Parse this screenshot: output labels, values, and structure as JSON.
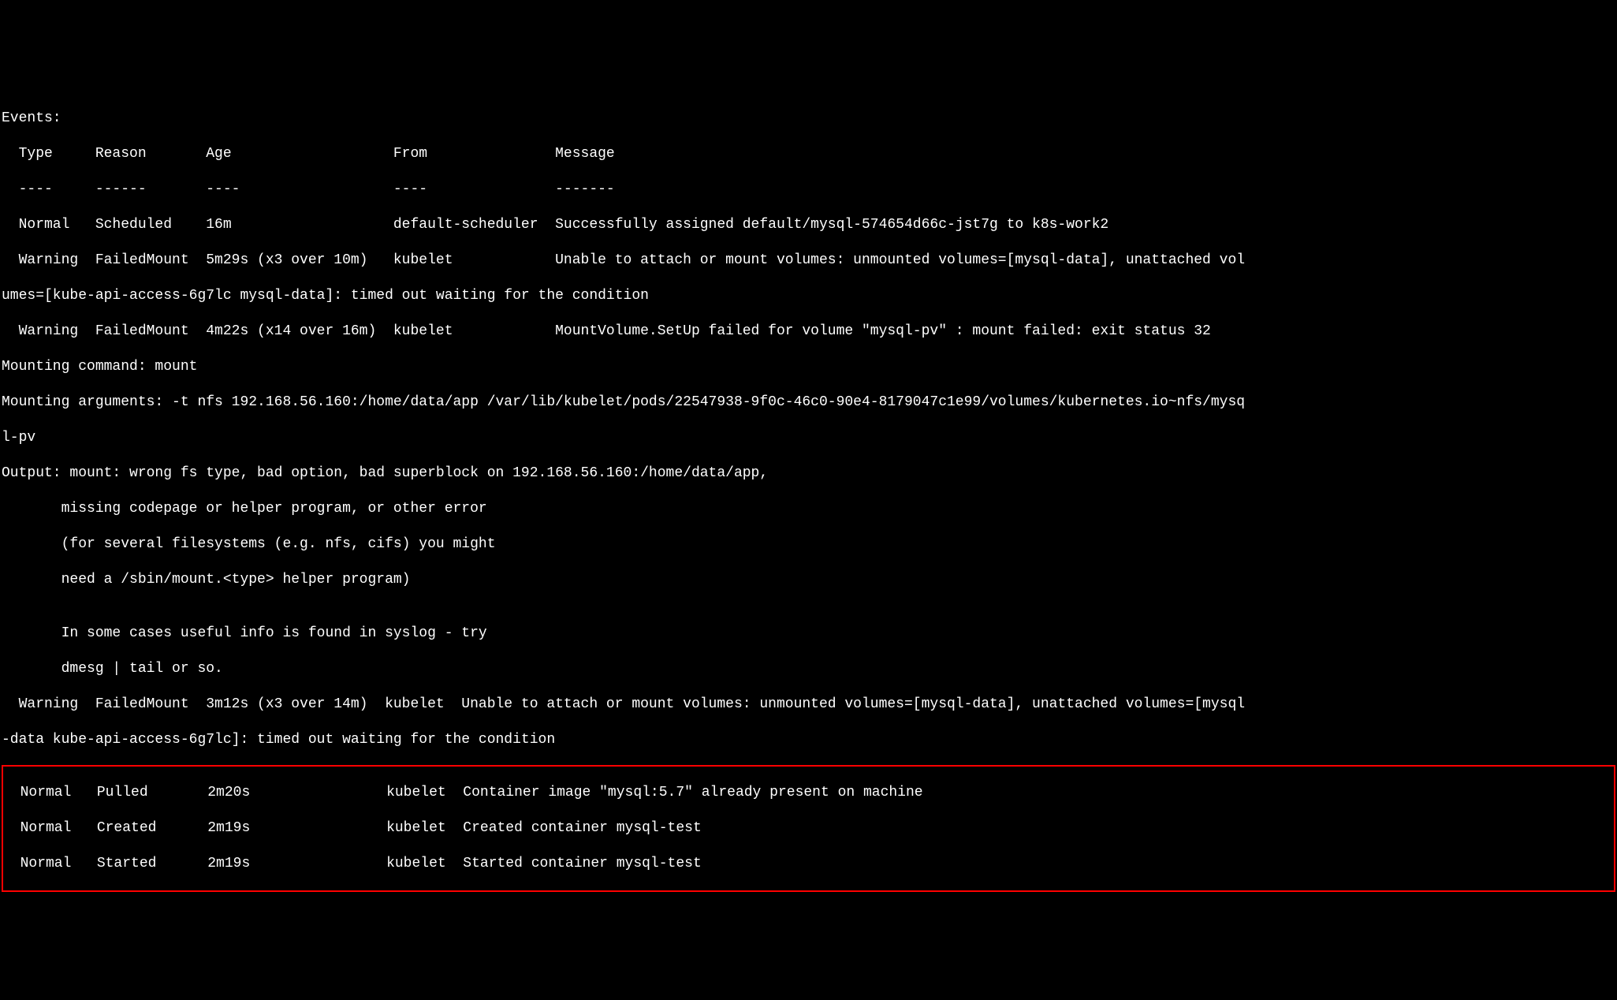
{
  "terminal": {
    "lines": [
      "Events:",
      "  Type     Reason       Age                   From               Message",
      "  ----     ------       ----                  ----               -------",
      "  Normal   Scheduled    16m                   default-scheduler  Successfully assigned default/mysql-574654d66c-jst7g to k8s-work2",
      "  Warning  FailedMount  5m29s (x3 over 10m)   kubelet            Unable to attach or mount volumes: unmounted volumes=[mysql-data], unattached vol",
      "umes=[kube-api-access-6g7lc mysql-data]: timed out waiting for the condition",
      "  Warning  FailedMount  4m22s (x14 over 16m)  kubelet            MountVolume.SetUp failed for volume \"mysql-pv\" : mount failed: exit status 32",
      "Mounting command: mount",
      "Mounting arguments: -t nfs 192.168.56.160:/home/data/app /var/lib/kubelet/pods/22547938-9f0c-46c0-90e4-8179047c1e99/volumes/kubernetes.io~nfs/mysq",
      "l-pv",
      "Output: mount: wrong fs type, bad option, bad superblock on 192.168.56.160:/home/data/app,",
      "       missing codepage or helper program, or other error",
      "       (for several filesystems (e.g. nfs, cifs) you might",
      "       need a /sbin/mount.<type> helper program)",
      "",
      "       In some cases useful info is found in syslog - try",
      "       dmesg | tail or so.",
      "  Warning  FailedMount  3m12s (x3 over 14m)  kubelet  Unable to attach or mount volumes: unmounted volumes=[mysql-data], unattached volumes=[mysql",
      "-data kube-api-access-6g7lc]: timed out waiting for the condition"
    ],
    "highlighted": [
      "  Normal   Pulled       2m20s                kubelet  Container image \"mysql:5.7\" already present on machine",
      "  Normal   Created      2m19s                kubelet  Created container mysql-test",
      "  Normal   Started      2m19s                kubelet  Started container mysql-test"
    ]
  }
}
